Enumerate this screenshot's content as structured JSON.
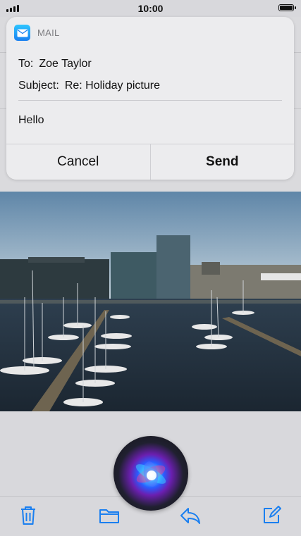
{
  "status_bar": {
    "time": "10:00"
  },
  "notification": {
    "app_name": "MAIL",
    "to_label": "To:",
    "to_value": "Zoe Taylor",
    "subject_label": "Subject:",
    "subject_value": "Re: Holiday picture",
    "message": "Hello",
    "cancel_label": "Cancel",
    "send_label": "Send"
  },
  "toolbar": {
    "icons": [
      "trash-icon",
      "folder-icon",
      "reply-icon",
      "compose-icon"
    ],
    "accent_color": "#1a7ff0"
  },
  "siri": {
    "icon": "siri-orb"
  }
}
